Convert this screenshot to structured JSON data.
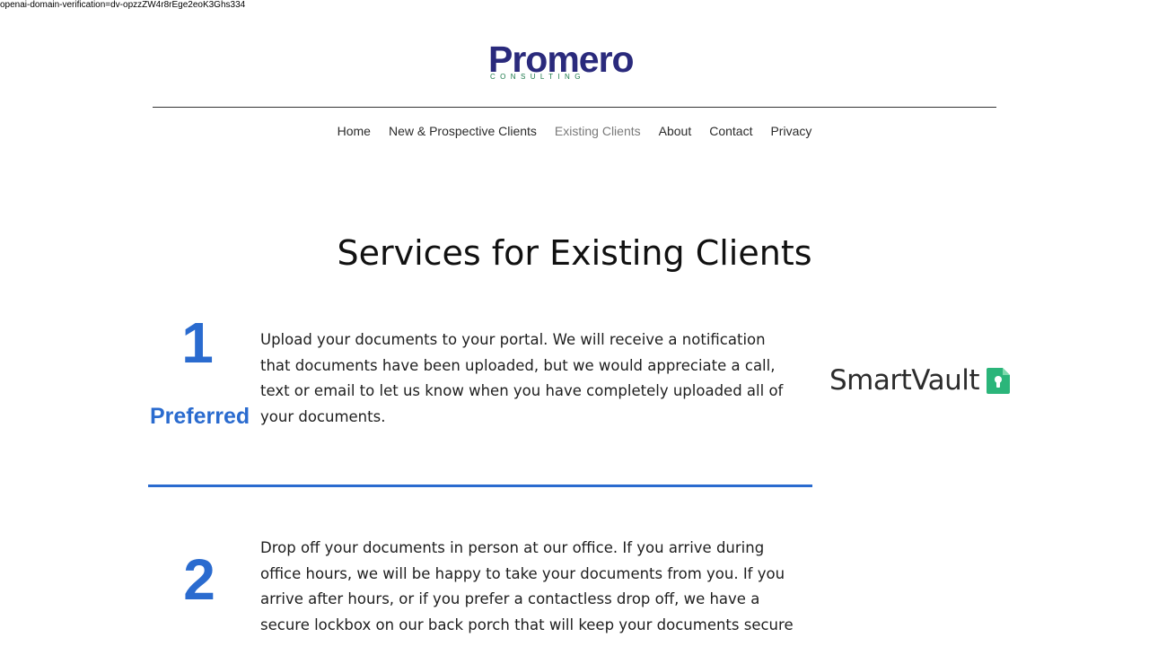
{
  "verification": {
    "text": "openai-domain-verification=dv-opzzZW4r8rEge2eoK3Ghs334"
  },
  "logo": {
    "word": "Promero",
    "sub": "CONSULTING",
    "word_color": "#2a2a7c",
    "sub_color": "#1c7a4a"
  },
  "nav": {
    "items": [
      {
        "label": "Home"
      },
      {
        "label": "New & Prospective Clients"
      },
      {
        "label": "Existing Clients"
      },
      {
        "label": "About"
      },
      {
        "label": "Contact"
      },
      {
        "label": "Privacy"
      }
    ],
    "active": "Existing Clients"
  },
  "main": {
    "title": "Services for Existing Clients",
    "steps": [
      {
        "number": "1",
        "tag": "Preferred",
        "text": "Upload your documents to your portal. We will receive a notification that documents have been uploaded, but we would appreciate a call, text or email to let us know when you have completely uploaded all of your documents."
      },
      {
        "number": "2",
        "text": "Drop off your documents in person at our office. If you arrive during office hours, we will be happy to take your documents from you. If you arrive after hours, or if you prefer a contactless drop off, we have a secure lockbox on our back porch that will keep your documents secure"
      }
    ],
    "accent_color": "#2a6bcf"
  },
  "smartvault": {
    "label": "SmartVault",
    "icon": "lock-file-icon",
    "icon_color": "#2bb57a"
  }
}
